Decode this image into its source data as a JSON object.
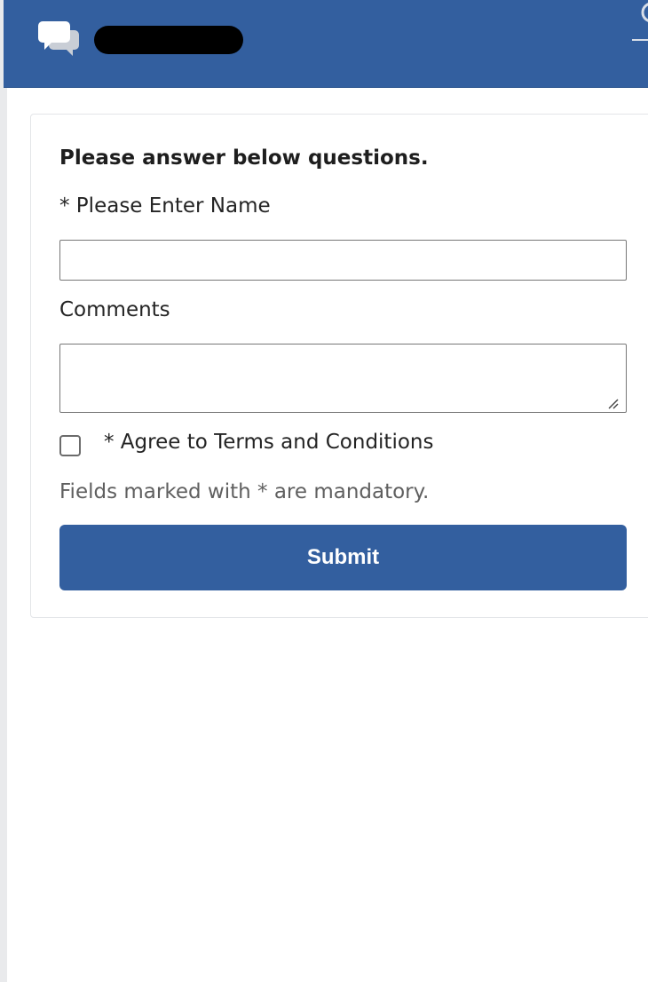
{
  "header": {
    "chat_icon": "chat-bubbles-icon",
    "user_icon": "user-icon",
    "title": "",
    "title_redacted": true,
    "background_color": "#335f9f"
  },
  "form": {
    "intro": "Please answer below questions.",
    "name_label": "* Please Enter Name",
    "name_value": "",
    "comments_label": "Comments",
    "comments_value": "",
    "terms_label": "* Agree to Terms and Conditions",
    "terms_checked": false,
    "mandatory_note": "Fields marked with * are mandatory.",
    "submit_label": "Submit",
    "accent_color": "#335f9f"
  }
}
